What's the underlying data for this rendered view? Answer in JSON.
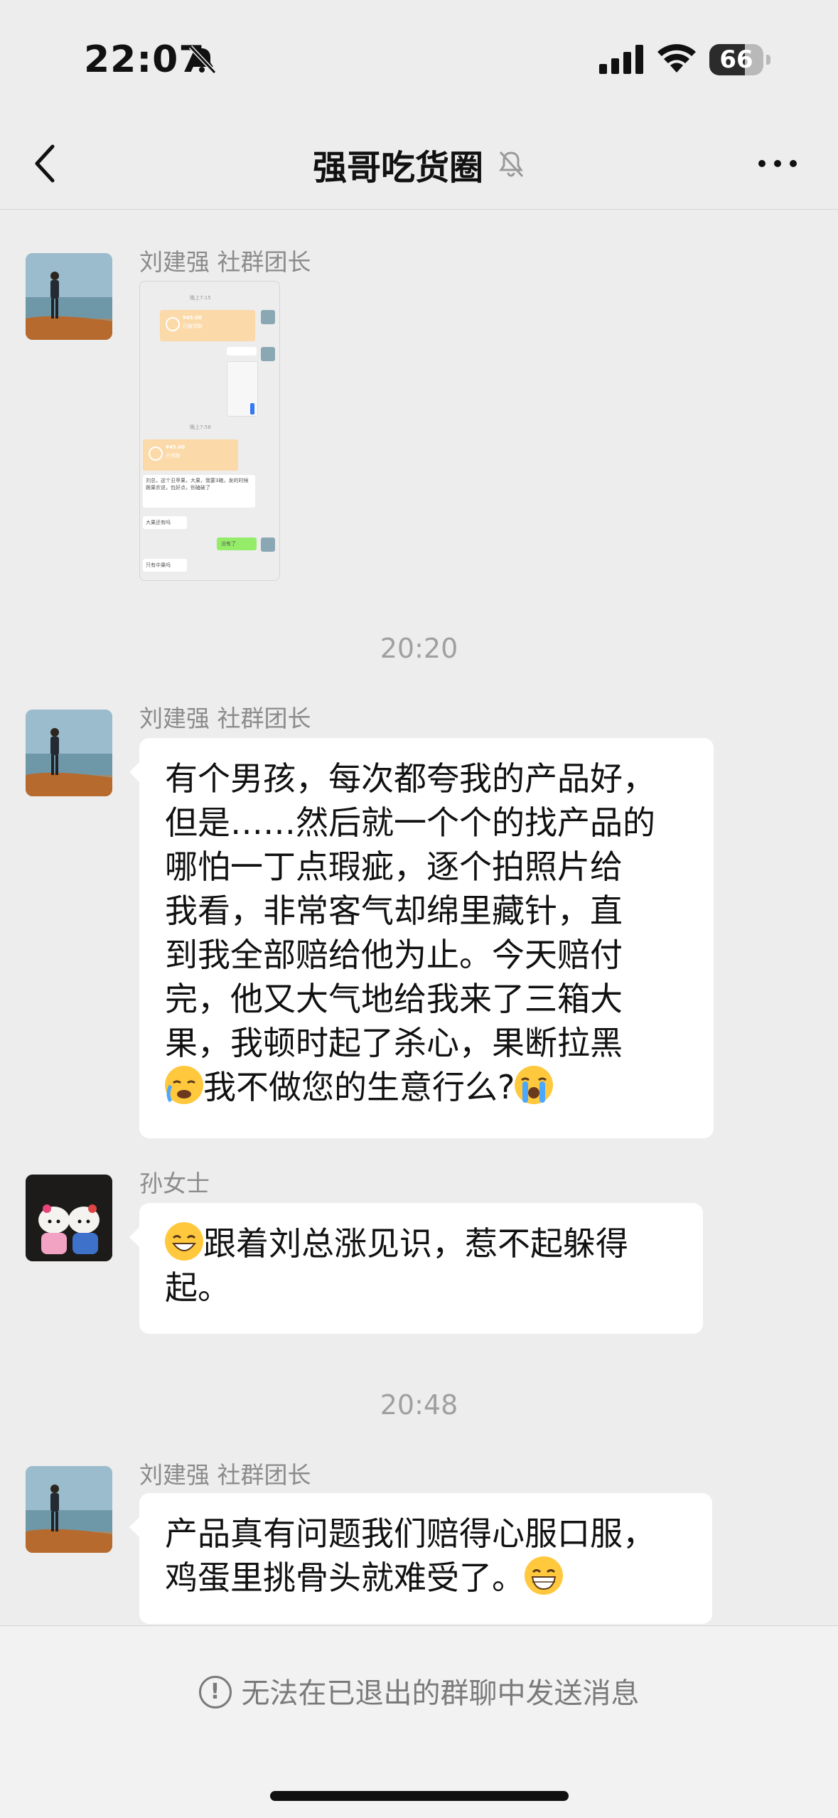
{
  "status_bar": {
    "time": "22:07",
    "battery": "66",
    "battery_level": 0.66
  },
  "nav": {
    "title": "强哥吃货圈"
  },
  "messages": [
    {
      "sender": "刘建强 社群团长",
      "type": "image"
    },
    {
      "timestamp": "20:20"
    },
    {
      "sender": "刘建强 社群团长",
      "text_lines": [
        "有个男孩，每次都夸我的产品好，",
        "但是……然后就一个个的找产品的",
        "哪怕一丁点瑕疵，逐个拍照片给",
        "我看，非常客气却绵里藏针，直",
        "到我全部赔给他为止。今天赔付",
        "完，他又大气地给我来了三箱大",
        "果，我顿时起了杀心，果断拉黑"
      ],
      "last_line": "我不做您的生意行么?"
    },
    {
      "sender": "孙女士",
      "line1": "跟着刘总涨见识，惹不起躲得",
      "line2": "起。"
    },
    {
      "timestamp": "20:48"
    },
    {
      "sender": "刘建强 社群团长",
      "line1": "产品真有问题我们赔得心服口服，",
      "line2": "鸡蛋里挑骨头就难受了。"
    }
  ],
  "screenshot_thumb": {
    "time1": "晚上7:15",
    "amount1": "¥45.00",
    "label1": "已被领取",
    "time2": "晚上7:58",
    "amount2": "¥45.00",
    "label2": "已领取",
    "msg1": "刘总，这个丑苹果，大果，我要3箱，发的时候跟果农说，包好点，别磕破了",
    "msg2": "大果还有吗",
    "msg3": "没有了",
    "msg4": "只有中果吗"
  },
  "footer": {
    "notice": "无法在已退出的群聊中发送消息"
  },
  "icons": [
    "bell-slash-icon",
    "signal-icon",
    "wifi-icon",
    "battery-icon",
    "back-chevron-icon",
    "more-dots-icon",
    "info-circle-icon"
  ]
}
